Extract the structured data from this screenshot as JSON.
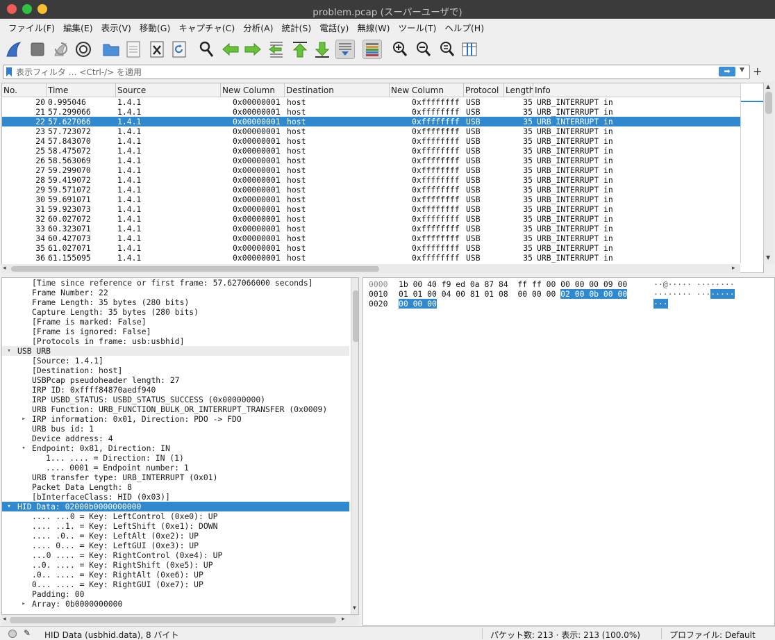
{
  "window": {
    "title": "problem.pcap (スーパーユーザで)"
  },
  "menubar": [
    "ファイル(F)",
    "編集(E)",
    "表示(V)",
    "移動(G)",
    "キャプチャ(C)",
    "分析(A)",
    "統計(S)",
    "電話(y)",
    "無線(W)",
    "ツール(T)",
    "ヘルプ(H)"
  ],
  "toolbar": {
    "icons": [
      "shark-fin-start-icon",
      "stop-square-icon",
      "restart-capture-icon",
      "capture-options-gear-icon",
      "open-folder-icon",
      "save-file-icon",
      "close-file-icon",
      "reload-file-icon",
      "find-packet-icon",
      "go-back-icon",
      "go-forward-icon",
      "go-to-packet-icon",
      "go-first-packet-icon",
      "go-last-packet-icon",
      "auto-scroll-icon",
      "colorize-icon",
      "zoom-in-icon",
      "zoom-out-icon",
      "zoom-normal-icon",
      "resize-columns-icon"
    ]
  },
  "filter": {
    "placeholder": "表示フィルタ … <Ctrl-/> を適用",
    "apply_icon": "arrow-right-icon",
    "dropdown_icon": "chevron-down-icon",
    "add_button": "+"
  },
  "packet_list": {
    "columns": [
      "No.",
      "Time",
      "Source",
      "New Column",
      "Destination",
      "New Column",
      "Protocol",
      "Length",
      "Info"
    ],
    "rows": [
      {
        "no": "20",
        "time": "0.995046",
        "src": "1.4.1",
        "nc1": "0x00000001",
        "dst": "host",
        "nc2": "0xffffffff",
        "proto": "USB",
        "len": "35",
        "info": "URB_INTERRUPT in",
        "selected": false
      },
      {
        "no": "21",
        "time": "57.299066",
        "src": "1.4.1",
        "nc1": "0x00000001",
        "dst": "host",
        "nc2": "0xffffffff",
        "proto": "USB",
        "len": "35",
        "info": "URB_INTERRUPT in",
        "selected": false
      },
      {
        "no": "22",
        "time": "57.627066",
        "src": "1.4.1",
        "nc1": "0x00000001",
        "dst": "host",
        "nc2": "0xffffffff",
        "proto": "USB",
        "len": "35",
        "info": "URB_INTERRUPT in",
        "selected": true
      },
      {
        "no": "23",
        "time": "57.723072",
        "src": "1.4.1",
        "nc1": "0x00000001",
        "dst": "host",
        "nc2": "0xffffffff",
        "proto": "USB",
        "len": "35",
        "info": "URB_INTERRUPT in",
        "selected": false
      },
      {
        "no": "24",
        "time": "57.843070",
        "src": "1.4.1",
        "nc1": "0x00000001",
        "dst": "host",
        "nc2": "0xffffffff",
        "proto": "USB",
        "len": "35",
        "info": "URB_INTERRUPT in",
        "selected": false
      },
      {
        "no": "25",
        "time": "58.475072",
        "src": "1.4.1",
        "nc1": "0x00000001",
        "dst": "host",
        "nc2": "0xffffffff",
        "proto": "USB",
        "len": "35",
        "info": "URB_INTERRUPT in",
        "selected": false
      },
      {
        "no": "26",
        "time": "58.563069",
        "src": "1.4.1",
        "nc1": "0x00000001",
        "dst": "host",
        "nc2": "0xffffffff",
        "proto": "USB",
        "len": "35",
        "info": "URB_INTERRUPT in",
        "selected": false
      },
      {
        "no": "27",
        "time": "59.299070",
        "src": "1.4.1",
        "nc1": "0x00000001",
        "dst": "host",
        "nc2": "0xffffffff",
        "proto": "USB",
        "len": "35",
        "info": "URB_INTERRUPT in",
        "selected": false
      },
      {
        "no": "28",
        "time": "59.419072",
        "src": "1.4.1",
        "nc1": "0x00000001",
        "dst": "host",
        "nc2": "0xffffffff",
        "proto": "USB",
        "len": "35",
        "info": "URB_INTERRUPT in",
        "selected": false
      },
      {
        "no": "29",
        "time": "59.571072",
        "src": "1.4.1",
        "nc1": "0x00000001",
        "dst": "host",
        "nc2": "0xffffffff",
        "proto": "USB",
        "len": "35",
        "info": "URB_INTERRUPT in",
        "selected": false
      },
      {
        "no": "30",
        "time": "59.691071",
        "src": "1.4.1",
        "nc1": "0x00000001",
        "dst": "host",
        "nc2": "0xffffffff",
        "proto": "USB",
        "len": "35",
        "info": "URB_INTERRUPT in",
        "selected": false
      },
      {
        "no": "31",
        "time": "59.923073",
        "src": "1.4.1",
        "nc1": "0x00000001",
        "dst": "host",
        "nc2": "0xffffffff",
        "proto": "USB",
        "len": "35",
        "info": "URB_INTERRUPT in",
        "selected": false
      },
      {
        "no": "32",
        "time": "60.027072",
        "src": "1.4.1",
        "nc1": "0x00000001",
        "dst": "host",
        "nc2": "0xffffffff",
        "proto": "USB",
        "len": "35",
        "info": "URB_INTERRUPT in",
        "selected": false
      },
      {
        "no": "33",
        "time": "60.323071",
        "src": "1.4.1",
        "nc1": "0x00000001",
        "dst": "host",
        "nc2": "0xffffffff",
        "proto": "USB",
        "len": "35",
        "info": "URB_INTERRUPT in",
        "selected": false
      },
      {
        "no": "34",
        "time": "60.427073",
        "src": "1.4.1",
        "nc1": "0x00000001",
        "dst": "host",
        "nc2": "0xffffffff",
        "proto": "USB",
        "len": "35",
        "info": "URB_INTERRUPT in",
        "selected": false
      },
      {
        "no": "35",
        "time": "61.027071",
        "src": "1.4.1",
        "nc1": "0x00000001",
        "dst": "host",
        "nc2": "0xffffffff",
        "proto": "USB",
        "len": "35",
        "info": "URB_INTERRUPT in",
        "selected": false
      },
      {
        "no": "36",
        "time": "61.155095",
        "src": "1.4.1",
        "nc1": "0x00000001",
        "dst": "host",
        "nc2": "0xffffffff",
        "proto": "USB",
        "len": "35",
        "info": "URB_INTERRUPT in",
        "selected": false
      }
    ]
  },
  "details": {
    "lines": [
      {
        "indent": 2,
        "arrow": "",
        "text": "[Time since reference or first frame: 57.627066000 seconds]",
        "kind": "normal"
      },
      {
        "indent": 2,
        "arrow": "",
        "text": "Frame Number: 22",
        "kind": "normal"
      },
      {
        "indent": 2,
        "arrow": "",
        "text": "Frame Length: 35 bytes (280 bits)",
        "kind": "normal"
      },
      {
        "indent": 2,
        "arrow": "",
        "text": "Capture Length: 35 bytes (280 bits)",
        "kind": "normal"
      },
      {
        "indent": 2,
        "arrow": "",
        "text": "[Frame is marked: False]",
        "kind": "normal"
      },
      {
        "indent": 2,
        "arrow": "",
        "text": "[Frame is ignored: False]",
        "kind": "normal"
      },
      {
        "indent": 2,
        "arrow": "",
        "text": "[Protocols in frame: usb:usbhid]",
        "kind": "normal"
      },
      {
        "indent": 1,
        "arrow": "▾",
        "text": "USB URB",
        "kind": "hdr"
      },
      {
        "indent": 2,
        "arrow": "",
        "text": "[Source: 1.4.1]",
        "kind": "normal"
      },
      {
        "indent": 2,
        "arrow": "",
        "text": "[Destination: host]",
        "kind": "normal"
      },
      {
        "indent": 2,
        "arrow": "",
        "text": "USBPcap pseudoheader length: 27",
        "kind": "normal"
      },
      {
        "indent": 2,
        "arrow": "",
        "text": "IRP ID: 0xffff84870aedf940",
        "kind": "normal"
      },
      {
        "indent": 2,
        "arrow": "",
        "text": "IRP USBD_STATUS: USBD_STATUS_SUCCESS (0x00000000)",
        "kind": "normal"
      },
      {
        "indent": 2,
        "arrow": "",
        "text": "URB Function: URB_FUNCTION_BULK_OR_INTERRUPT_TRANSFER (0x0009)",
        "kind": "normal"
      },
      {
        "indent": 2,
        "arrow": "▸",
        "text": "IRP information: 0x01, Direction: PDO -> FDO",
        "kind": "normal"
      },
      {
        "indent": 2,
        "arrow": "",
        "text": "URB bus id: 1",
        "kind": "normal"
      },
      {
        "indent": 2,
        "arrow": "",
        "text": "Device address: 4",
        "kind": "normal"
      },
      {
        "indent": 2,
        "arrow": "▾",
        "text": "Endpoint: 0x81, Direction: IN",
        "kind": "normal"
      },
      {
        "indent": 3,
        "arrow": "",
        "text": "1... .... = Direction: IN (1)",
        "kind": "normal"
      },
      {
        "indent": 3,
        "arrow": "",
        "text": ".... 0001 = Endpoint number: 1",
        "kind": "normal"
      },
      {
        "indent": 2,
        "arrow": "",
        "text": "URB transfer type: URB_INTERRUPT (0x01)",
        "kind": "normal"
      },
      {
        "indent": 2,
        "arrow": "",
        "text": "Packet Data Length: 8",
        "kind": "normal"
      },
      {
        "indent": 2,
        "arrow": "",
        "text": "[bInterfaceClass: HID (0x03)]",
        "kind": "normal"
      },
      {
        "indent": 1,
        "arrow": "▾",
        "text": "HID Data: 02000b0000000000",
        "kind": "sel"
      },
      {
        "indent": 2,
        "arrow": "",
        "text": ".... ...0 = Key: LeftControl (0xe0): UP",
        "kind": "normal"
      },
      {
        "indent": 2,
        "arrow": "",
        "text": ".... ..1. = Key: LeftShift (0xe1): DOWN",
        "kind": "normal"
      },
      {
        "indent": 2,
        "arrow": "",
        "text": ".... .0.. = Key: LeftAlt (0xe2): UP",
        "kind": "normal"
      },
      {
        "indent": 2,
        "arrow": "",
        "text": ".... 0... = Key: LeftGUI (0xe3): UP",
        "kind": "normal"
      },
      {
        "indent": 2,
        "arrow": "",
        "text": "...0 .... = Key: RightControl (0xe4): UP",
        "kind": "normal"
      },
      {
        "indent": 2,
        "arrow": "",
        "text": "..0. .... = Key: RightShift (0xe5): UP",
        "kind": "normal"
      },
      {
        "indent": 2,
        "arrow": "",
        "text": ".0.. .... = Key: RightAlt (0xe6): UP",
        "kind": "normal"
      },
      {
        "indent": 2,
        "arrow": "",
        "text": "0... .... = Key: RightGUI (0xe7): UP",
        "kind": "normal"
      },
      {
        "indent": 2,
        "arrow": "",
        "text": "Padding: 00",
        "kind": "normal"
      },
      {
        "indent": 2,
        "arrow": "▸",
        "text": "Array: 0b0000000000",
        "kind": "normal"
      }
    ]
  },
  "bytes": {
    "rows": [
      {
        "offset": "0000",
        "hex_plain": "1b 00 40 f9 ed 0a 87 84  ff ff 00 00 00 00 09 00",
        "hex_hl": "",
        "hex_rest": "",
        "ascii_plain": "··@····· ········",
        "ascii_hl": "",
        "offset_dim": true
      },
      {
        "offset": "0010",
        "hex_plain": "01 01 00 04 00 81 01 08  00 00 00 ",
        "hex_hl": "02 00 0b 00 00",
        "hex_rest": "",
        "ascii_plain": "········ ···",
        "ascii_hl": "·····",
        "offset_dim": false
      },
      {
        "offset": "0020",
        "hex_plain": "",
        "hex_hl": "00 00 00",
        "hex_rest": "",
        "ascii_plain": "",
        "ascii_hl": "···",
        "offset_dim": false
      }
    ]
  },
  "statusbar": {
    "field": "HID Data (usbhid.data), 8 バイト",
    "packets": "パケット数: 213 · 表示: 213 (100.0%)",
    "profile": "プロファイル: Default",
    "status_icon": "capture-status-dot-icon",
    "edit_icon": "edit-comment-icon"
  },
  "colors": {
    "selection": "#3089cf",
    "titlebar": "#3b3b3b"
  }
}
